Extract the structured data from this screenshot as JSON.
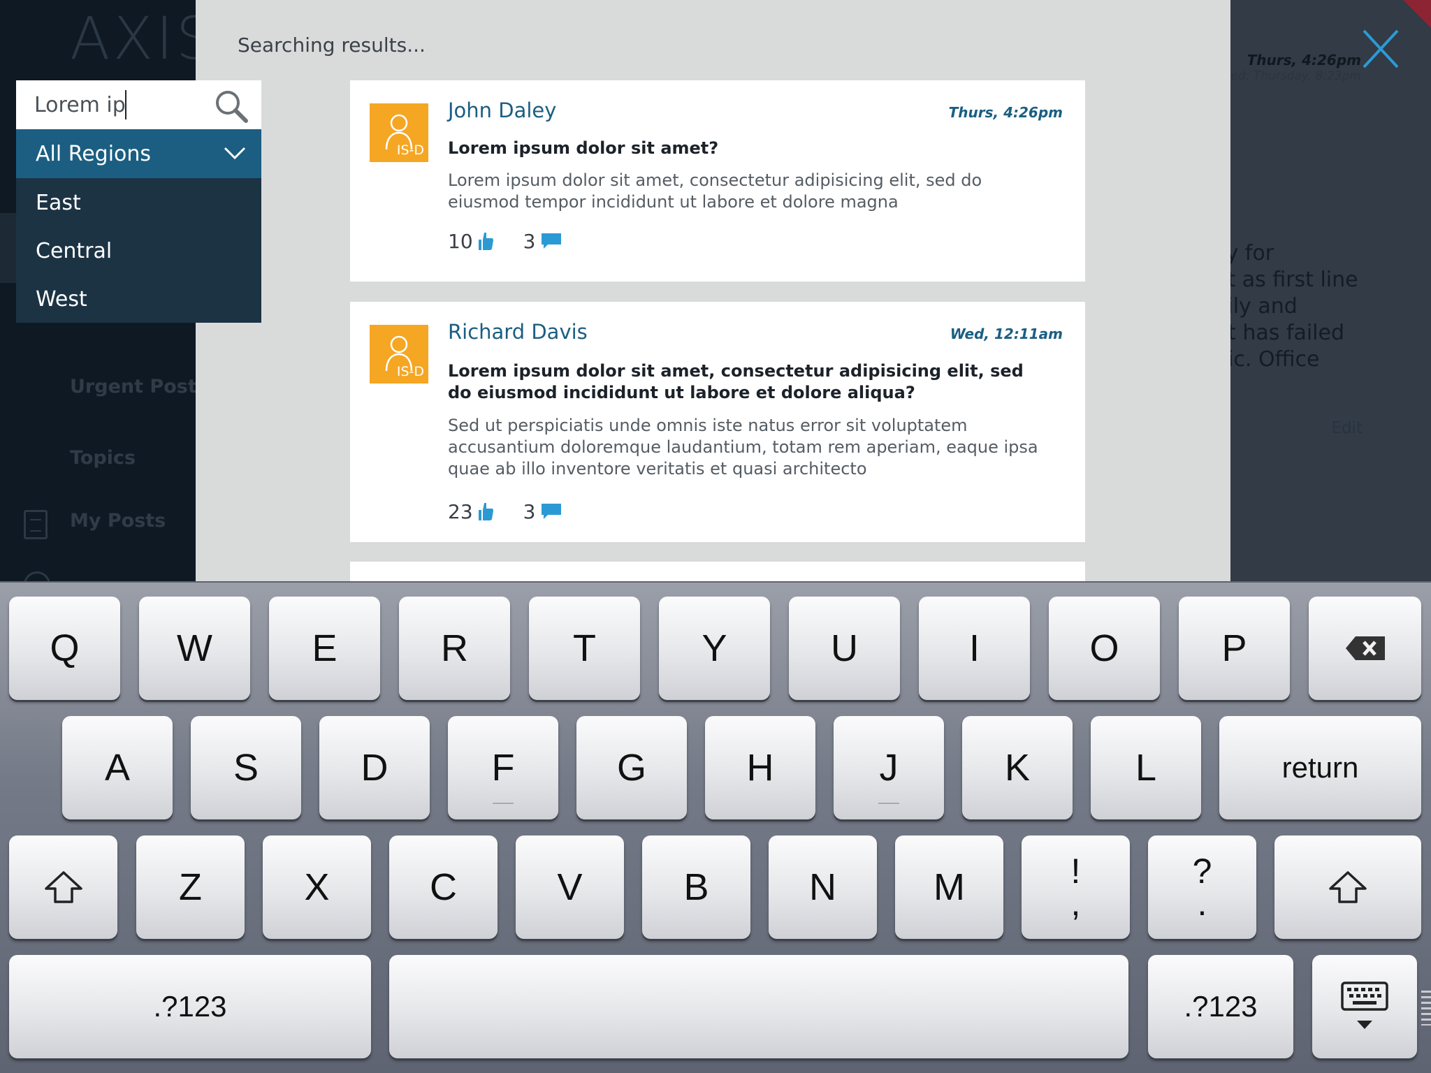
{
  "app": {
    "logo": "AXIS",
    "nav_items": [
      "Urgent Posts",
      "Topics",
      "My Posts"
    ],
    "bg_time": "Thurs, 4:26pm",
    "bg_time_secondary": "ed: Thursday, 8:23pm",
    "bg_text_lines": [
      "cy for",
      "et as first line",
      "aily and",
      "nt has failed",
      "gic. Office"
    ],
    "bg_edit": "Edit"
  },
  "search": {
    "status": "Searching results...",
    "query": "Lorem ip",
    "icons": {
      "search": "search-icon",
      "close": "close-icon"
    }
  },
  "region": {
    "selected": "All Regions",
    "options": [
      "East",
      "Central",
      "West"
    ],
    "icon": "chevron-down-icon"
  },
  "results": [
    {
      "author": "John Daley",
      "avatar_initials": "IS-D",
      "time": "Thurs, 4:26pm",
      "title": "Lorem ipsum dolor sit amet?",
      "body": "Lorem ipsum dolor sit amet, consectetur adipisicing elit, sed do eiusmod tempor incididunt ut labore et dolore magna",
      "likes": "10",
      "comments": "3"
    },
    {
      "author": "Richard Davis",
      "avatar_initials": "IS-D",
      "time": "Wed, 12:11am",
      "title": "Lorem ipsum dolor sit amet, consectetur adipisicing elit, sed do eiusmod incididunt ut labore et dolore aliqua?",
      "body": "Sed ut perspiciatis unde omnis iste natus error sit voluptatem accusantium doloremque laudantium, totam rem aperiam, eaque ipsa quae ab illo inventore veritatis et quasi architecto",
      "likes": "23",
      "comments": "3"
    }
  ],
  "colors": {
    "accent": "#1b5e82",
    "avatar": "#f5a623",
    "dropdown_bg": "#1c3344",
    "overlay_bg": "#d9dbdb"
  },
  "keyboard": {
    "row1": [
      "Q",
      "W",
      "E",
      "R",
      "T",
      "Y",
      "U",
      "I",
      "O",
      "P"
    ],
    "row2": [
      "A",
      "S",
      "D",
      "F",
      "G",
      "H",
      "J",
      "K",
      "L"
    ],
    "row3": [
      "Z",
      "X",
      "C",
      "V",
      "B",
      "N",
      "M"
    ],
    "punct1": [
      "!",
      ","
    ],
    "punct2": [
      "?",
      "."
    ],
    "return_label": "return",
    "numbers_label": ".?123",
    "icons": {
      "backspace": "backspace-icon",
      "shift": "shift-icon",
      "dismiss": "keyboard-dismiss-icon"
    }
  }
}
